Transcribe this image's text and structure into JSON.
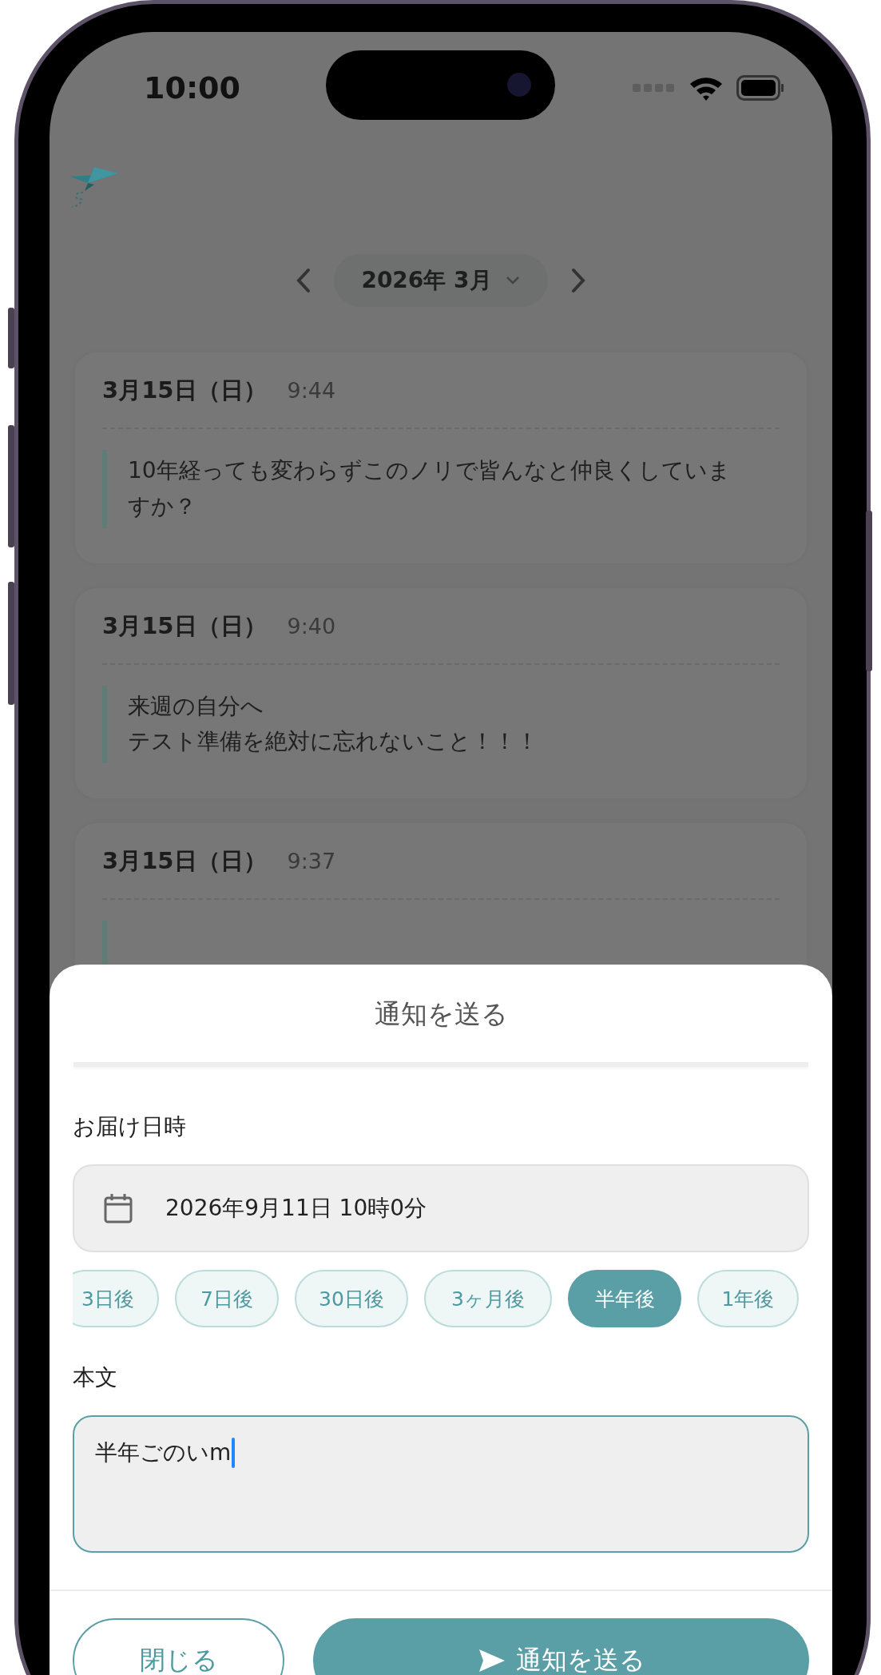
{
  "status_bar": {
    "time": "10:00"
  },
  "month_nav": {
    "label": "2026年 3月"
  },
  "entries": [
    {
      "date": "3月15日（日）",
      "time": "9:44",
      "message": [
        "10年経っても変わらずこのノリで皆んなと仲良くしていますか？"
      ]
    },
    {
      "date": "3月15日（日）",
      "time": "9:40",
      "message": [
        "来週の自分へ",
        "テスト準備を絶対に忘れないこと！！！"
      ]
    },
    {
      "date": "3月15日（日）",
      "time": "9:37"
    }
  ],
  "sheet": {
    "title": "通知を送る",
    "delivery_label": "お届け日時",
    "delivery_value": "2026年9月11日 10時0分",
    "presets": [
      {
        "label": "3日後",
        "selected": false
      },
      {
        "label": "7日後",
        "selected": false
      },
      {
        "label": "30日後",
        "selected": false
      },
      {
        "label": "3ヶ月後",
        "selected": false
      },
      {
        "label": "半年後",
        "selected": true
      },
      {
        "label": "1年後",
        "selected": false
      }
    ],
    "body_label": "本文",
    "body_value": "半年ごのいm",
    "buttons": [
      {
        "label": "閉じる",
        "kind": "secondary"
      },
      {
        "label": "通知を送る",
        "kind": "primary"
      }
    ]
  }
}
